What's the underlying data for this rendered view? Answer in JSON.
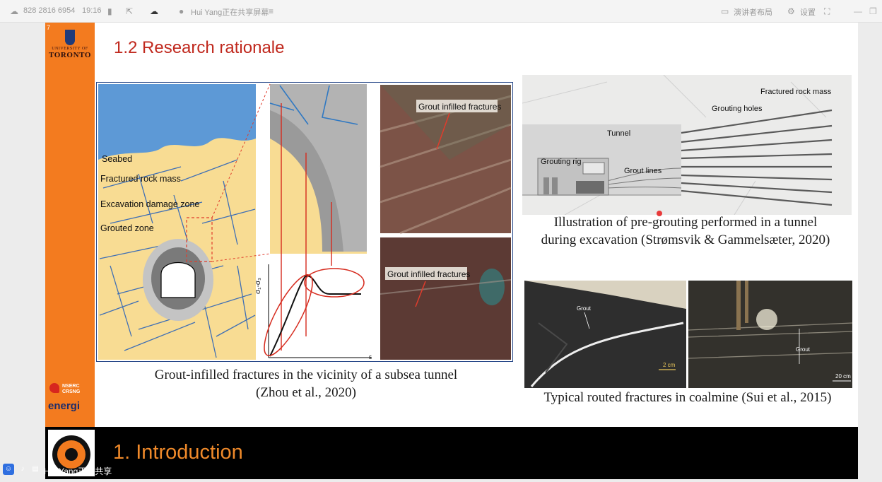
{
  "topbar": {
    "meeting_id": "828 2816 6954",
    "time": "19:16",
    "sharing_status": "Hui Yang正在共享屏幕",
    "layout_label": "演讲者布局",
    "settings_label": "设置"
  },
  "slide": {
    "page_number": "7",
    "university_small": "UNIVERSITY OF",
    "university_name": "TORONTO",
    "nserc_line1": "NSERC",
    "nserc_line2": "CRSNG",
    "energi_logo": "energi",
    "title": "1.2 Research rationale",
    "figure1": {
      "labels": {
        "seabed": "Seabed",
        "fractured_rock_mass": "Fractured rock mass",
        "excavation_damage_zone": "Excavation damage zone",
        "grouted_zone": "Grouted zone",
        "photo_top_label": "Grout infilled fractures",
        "photo_bottom_label": "Grout infilled fractures",
        "axis_y": "σ₁-σ₃",
        "axis_x": "ε"
      },
      "caption_line1": "Grout-infilled fractures in the vicinity of a subsea tunnel",
      "caption_line2": "(Zhou et al., 2020)"
    },
    "figure2": {
      "labels": {
        "fractured_rock_mass": "Fractured rock mass",
        "grouting_holes": "Grouting holes",
        "tunnel": "Tunnel",
        "grouting_rig": "Grouting rig",
        "grout_lines": "Grout lines"
      },
      "caption_line1": "Illustration of pre-grouting performed in a tunnel",
      "caption_line2": "during excavation (Strømsvik & Gammelsæter, 2020)"
    },
    "figure3": {
      "labels": {
        "grout_left": "Grout",
        "scale_left": "2 cm",
        "grout_right": "Grout",
        "scale_right": "20 cm"
      },
      "caption": "Typical routed fractures in coalmine (Sui et al., 2015)"
    },
    "section_title": "1. Introduction"
  },
  "share_strip": {
    "label": "Hui Yang正在共享"
  },
  "colors": {
    "accent_orange": "#f37b1f",
    "title_red": "#c0281d",
    "section_orange": "#f08a2a"
  }
}
